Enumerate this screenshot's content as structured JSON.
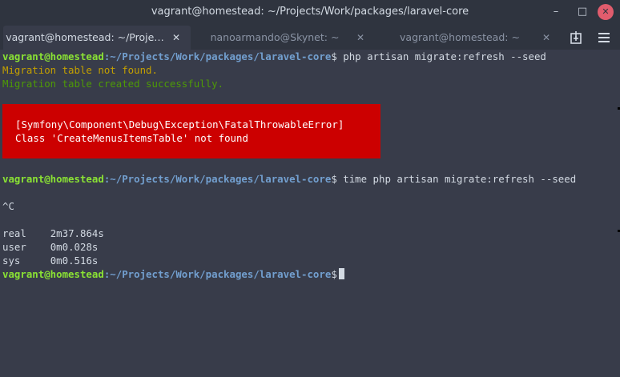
{
  "window": {
    "title": "vagrant@homestead: ~/Projects/Work/packages/laravel-core",
    "controls": {
      "minimize": "–",
      "maximize": "□",
      "close": "✕"
    }
  },
  "tabs": [
    {
      "label": "vagrant@homestead: ~/Proje…",
      "close": "✕"
    },
    {
      "label": "nanoarmando@Skynet: ~",
      "close": "✕"
    },
    {
      "label": "vagrant@homestead: ~",
      "close": "✕"
    }
  ],
  "icons": {
    "new_tab": "new-tab-icon",
    "menu": "hamburger-menu-icon"
  },
  "terminal": {
    "prompt_user": "vagrant@homestead",
    "prompt_path": ":~/Projects/Work/packages/laravel-core",
    "prompt_symbol": "$",
    "cmd1": " php artisan migrate:refresh --seed",
    "out_not_found": "Migration table not found.",
    "out_created": "Migration table created successfully.",
    "error_line1": "[Symfony\\Component\\Debug\\Exception\\FatalThrowableError]",
    "error_line2": "Class 'CreateMenusItemsTable' not found",
    "cmd2": " time php artisan migrate:refresh --seed",
    "interrupt": "^C",
    "real": "real\t2m37.864s",
    "user": "user\t0m0.028s",
    "sys": "sys\t0m0.516s"
  },
  "colors": {
    "background": "#383c4a",
    "titlebar": "#2f343f",
    "user": "#8ae234",
    "path": "#729fcf",
    "warning": "#c4a000",
    "success": "#4e9a06",
    "error_bg": "#cc0000",
    "close_button": "#e15c6d"
  }
}
